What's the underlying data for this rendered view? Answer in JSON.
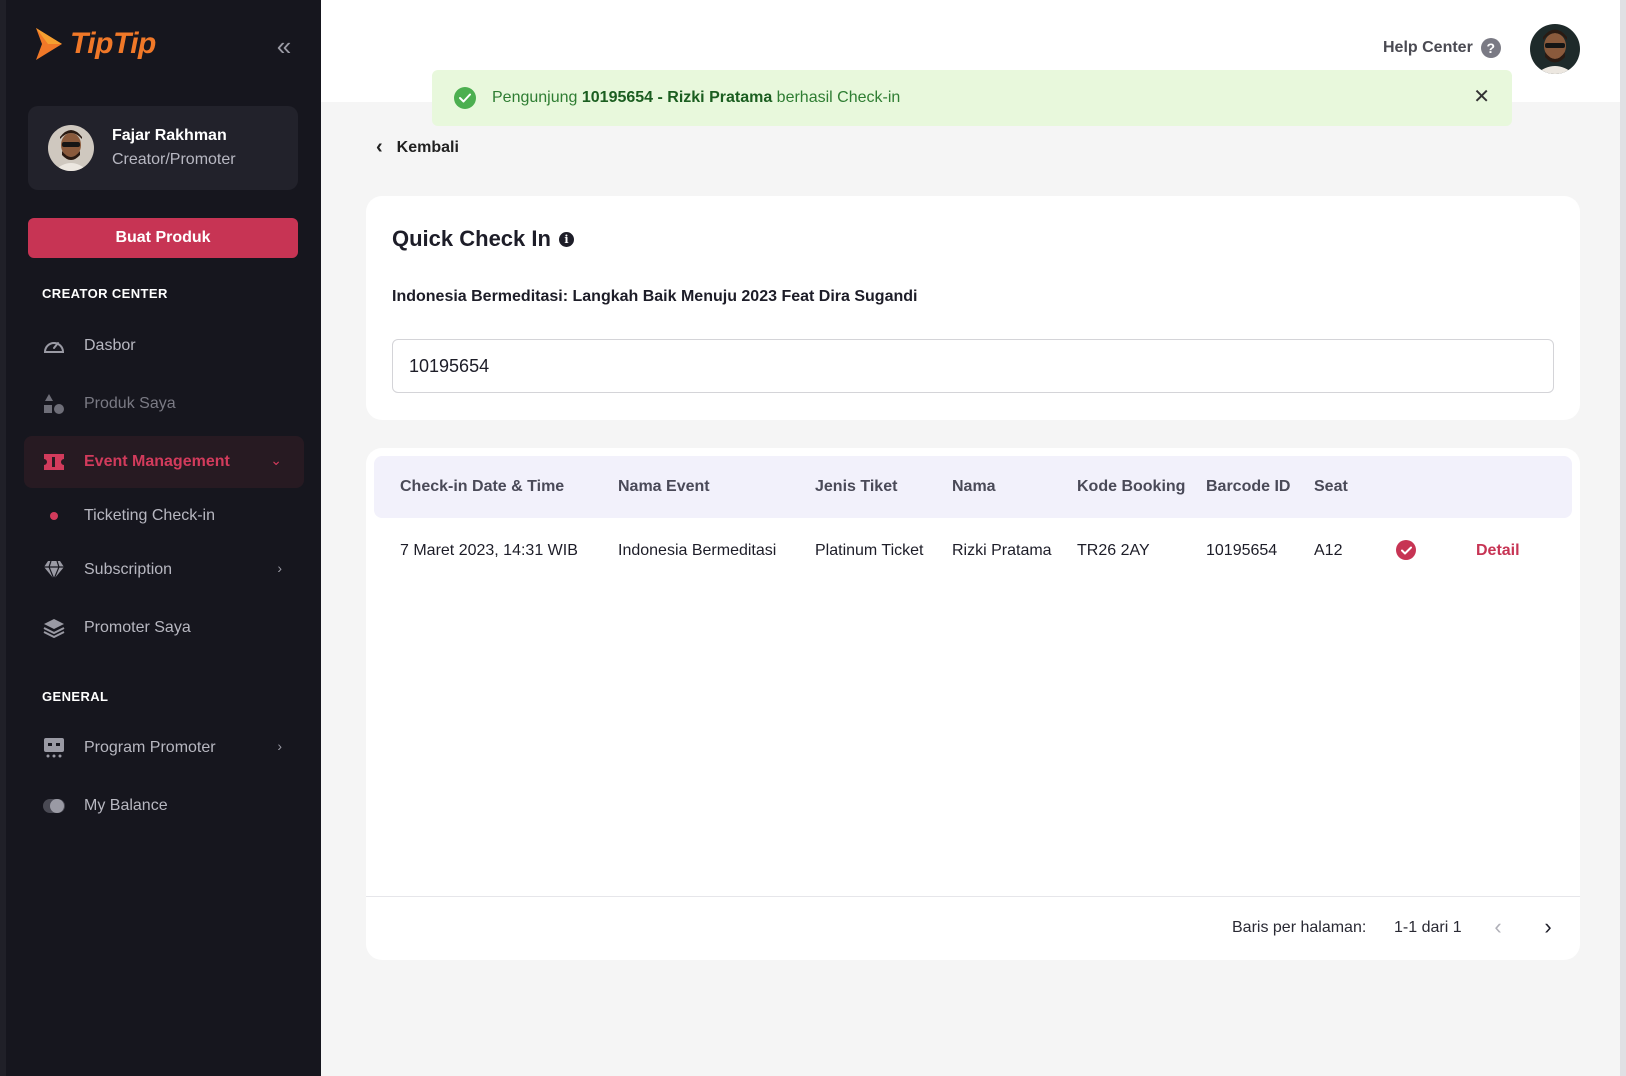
{
  "app": {
    "brand": "TipTip",
    "accent": "#c73454",
    "sidebar_bg": "#16161e"
  },
  "sidebar": {
    "profile": {
      "name": "Fajar Rakhman",
      "role": "Creator/Promoter"
    },
    "create_button": "Buat Produk",
    "sections": {
      "creator_center": "CREATOR CENTER",
      "general": "GENERAL"
    },
    "items": {
      "dashboard": {
        "label": "Dasbor",
        "icon": "speedometer-icon"
      },
      "products": {
        "label": "Produk Saya",
        "icon": "shapes-icon"
      },
      "event_management": {
        "label": "Event Management",
        "icon": "ticket-icon"
      },
      "ticketing_checkin": {
        "label": "Ticketing Check-in"
      },
      "subscription": {
        "label": "Subscription",
        "icon": "diamond-icon"
      },
      "promoter_saya": {
        "label": "Promoter Saya",
        "icon": "layers-icon"
      },
      "program_promoter": {
        "label": "Program Promoter",
        "icon": "promoter-icon"
      },
      "my_balance": {
        "label": "My Balance",
        "icon": "toggle-icon"
      }
    }
  },
  "header": {
    "help_center": "Help Center"
  },
  "toast": {
    "prefix": "Pengunjung",
    "highlight": "10195654 - Rizki Pratama",
    "suffix": "berhasil Check-in"
  },
  "back": {
    "label": "Kembali"
  },
  "quick_check_in": {
    "title": "Quick Check In",
    "event_title": "Indonesia Bermeditasi: Langkah Baik Menuju 2023 Feat Dira Sugandi",
    "input_value": "10195654"
  },
  "table": {
    "columns": {
      "datetime": "Check-in Date & Time",
      "event": "Nama Event",
      "ticket": "Jenis Tiket",
      "name": "Nama",
      "booking": "Kode Booking",
      "barcode": "Barcode ID",
      "seat": "Seat"
    },
    "rows": [
      {
        "datetime": "7 Maret 2023, 14:31 WIB",
        "event": "Indonesia Bermeditasi",
        "ticket": "Platinum Ticket",
        "name": "Rizki Pratama",
        "booking": "TR26 2AY",
        "barcode": "10195654",
        "seat": "A12",
        "status_icon": "check-circle-icon",
        "action": "Detail"
      }
    ],
    "footer": {
      "rows_per_page_label": "Baris per halaman:",
      "page_info": "1-1 dari 1"
    }
  }
}
